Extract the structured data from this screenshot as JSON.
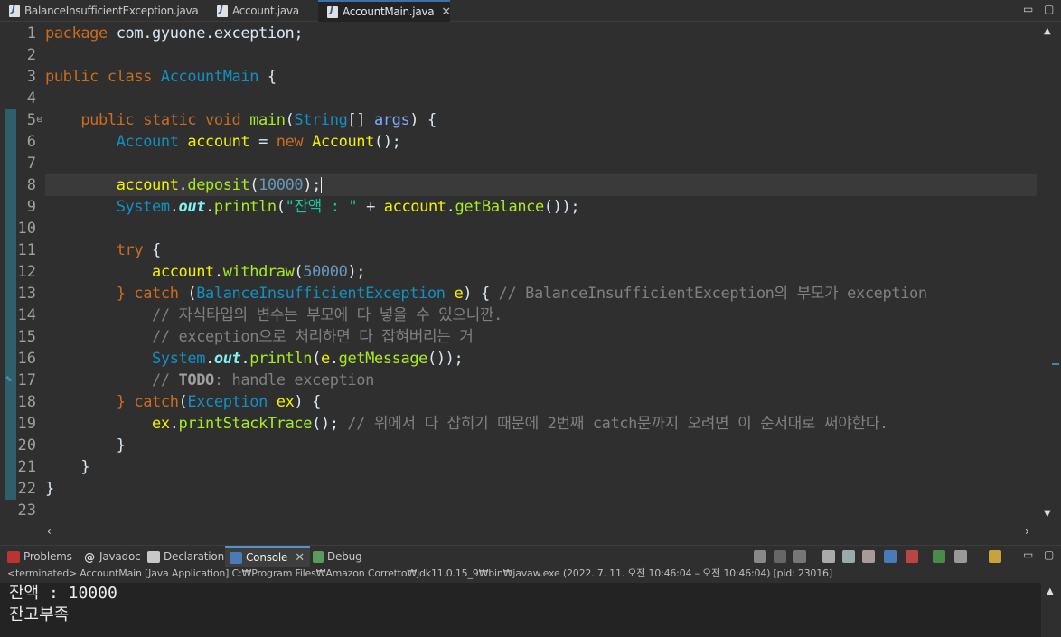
{
  "tabs": [
    {
      "label": "BalanceInsufficientException.java",
      "active": false
    },
    {
      "label": "Account.java",
      "active": false
    },
    {
      "label": "AccountMain.java",
      "active": true
    }
  ],
  "window_controls": {
    "minimize": "▭",
    "maximize": "▢"
  },
  "editor": {
    "line_numbers": [
      "1",
      "2",
      "3",
      "4",
      "5",
      "6",
      "7",
      "8",
      "9",
      "10",
      "11",
      "12",
      "13",
      "14",
      "15",
      "16",
      "17",
      "18",
      "19",
      "20",
      "21",
      "22",
      "23"
    ],
    "current_line": 8
  },
  "views": {
    "tabs": [
      {
        "label": "Problems",
        "active": false
      },
      {
        "label": "Javadoc",
        "active": false
      },
      {
        "label": "Declaration",
        "active": false
      },
      {
        "label": "Console",
        "active": true
      },
      {
        "label": "Debug",
        "active": false
      }
    ],
    "status": "<terminated> AccountMain [Java Application] C:₩Program Files₩Amazon Corretto₩jdk11.0.15_9₩bin₩javaw.exe  (2022. 7. 11. 오전 10:46:04 – 오전 10:46:04) [pid: 23016]",
    "output": [
      "잔액 : 10000",
      "잔고부족"
    ]
  },
  "colors": {
    "keyword": "#cc6c1d",
    "type": "#1290c3",
    "method": "#a7ec21",
    "string": "#17c6a3",
    "comment": "#808080",
    "background": "#2f2f2f"
  }
}
